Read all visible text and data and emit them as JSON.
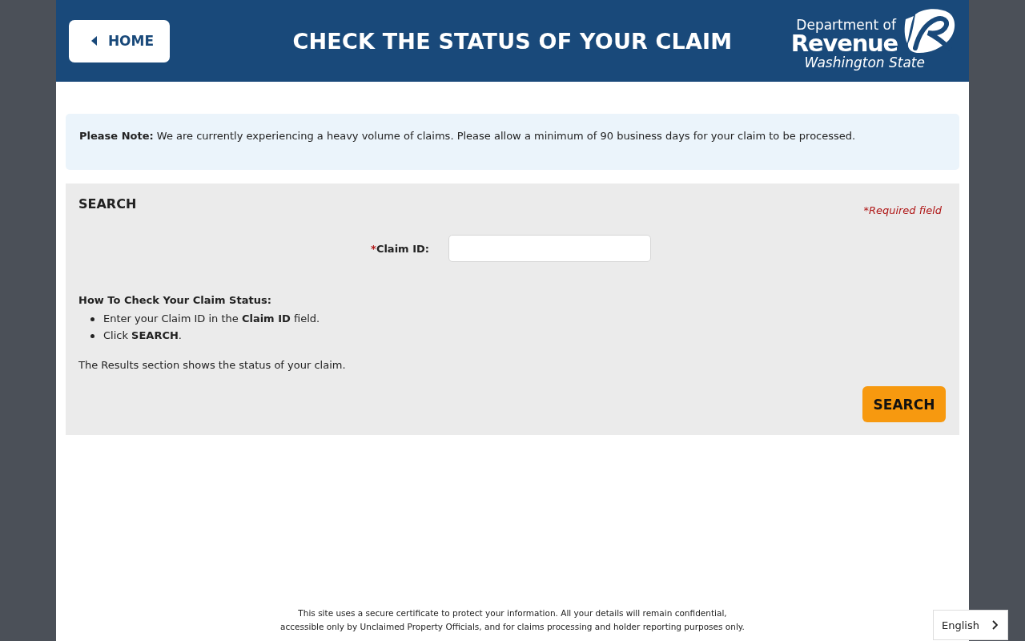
{
  "header": {
    "home_button": {
      "label": "HOME"
    },
    "title": "CHECK THE STATUS OF YOUR CLAIM",
    "logo": {
      "line_1": "Department of",
      "line_2": "Revenue",
      "line_3": "Washington State"
    }
  },
  "notice": {
    "text": "**Please Note:** We are currently experiencing a heavy volume of claims. Please allow a minimum of 90 business days for your claim to be processed."
  },
  "search_panel": {
    "heading": "SEARCH",
    "required_note": "*Required field",
    "field": {
      "required_mark": "*",
      "label": "Claim ID:"
    },
    "instructions": {
      "heading": "How To Check Your Claim Status:",
      "steps": [
        "Enter your Claim ID in the **Claim ID** field.",
        "Click **SEARCH**."
      ],
      "note": "The Results section shows the status of your claim."
    },
    "button": "SEARCH"
  },
  "footer": {
    "lines": [
      "This site uses a secure certificate to protect your information. All your details will remain confidential,",
      "accessible only by Unclaimed Property Officials, and for claims processing and holder reporting purposes only."
    ]
  },
  "language": {
    "label": "English"
  }
}
